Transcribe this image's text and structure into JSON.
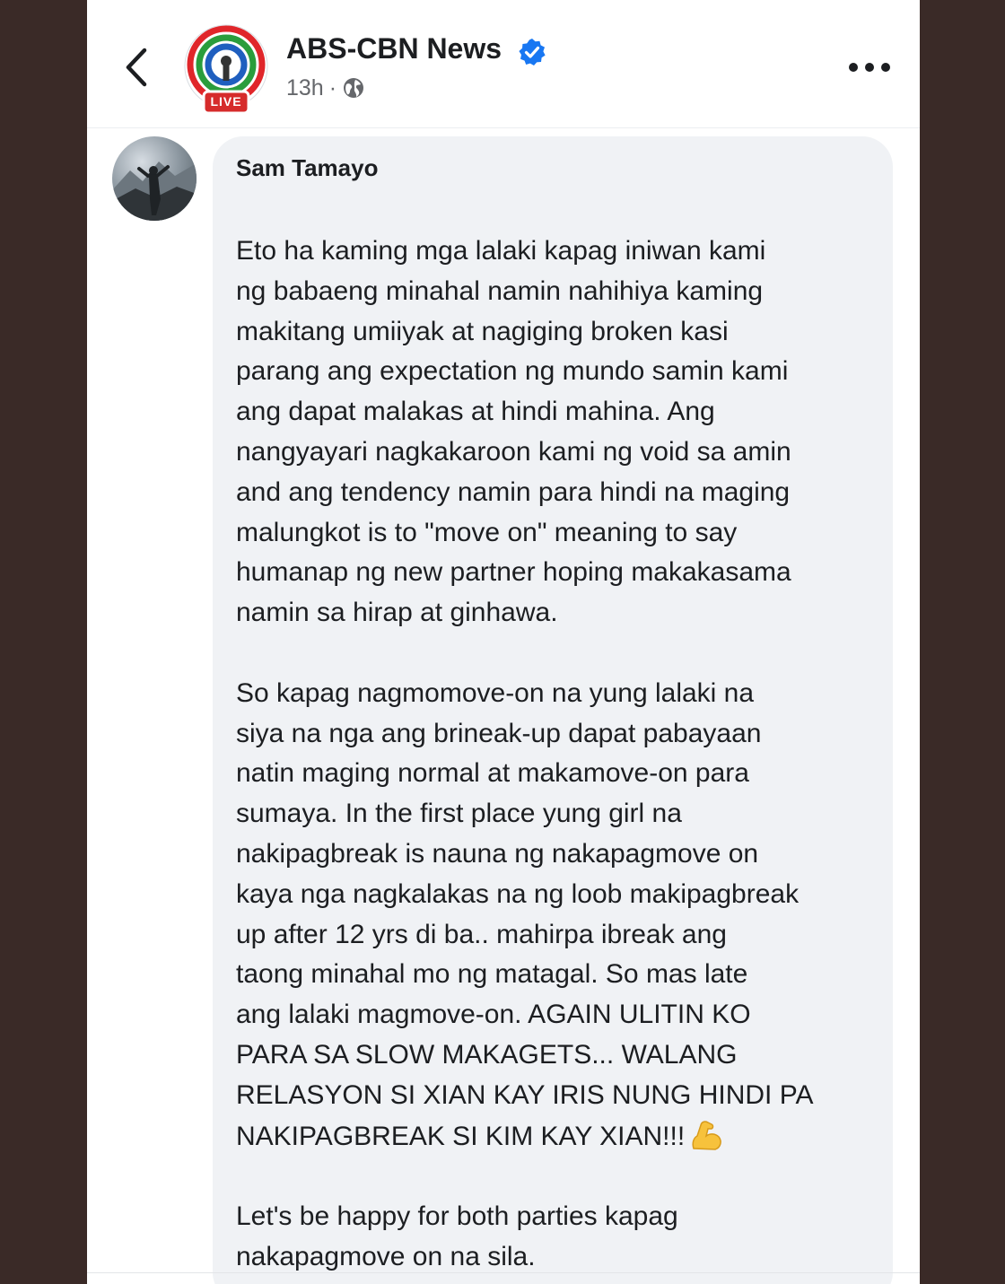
{
  "colors": {
    "frame": "#3a2a27",
    "surface": "#ffffff",
    "bubble": "#f0f2f5",
    "text_primary": "#1c1e21",
    "text_secondary": "#65676b",
    "verified": "#1877f2",
    "live_red": "#d62b2b"
  },
  "header": {
    "back_icon": "chevron-left-icon",
    "page_name": "ABS-CBN News",
    "verified_icon": "verified-badge-icon",
    "live_badge": "LIVE",
    "timestamp": "13h",
    "separator": "·",
    "audience_icon": "globe-icon",
    "more_icon": "more-horizontal-icon"
  },
  "comment": {
    "author": "Sam Tamayo",
    "paragraphs": [
      "Eto ha kaming mga lalaki kapag iniwan kami\nng babaeng minahal namin nahihiya kaming\nmakitang umiiyak at nagiging broken kasi\nparang ang expectation ng mundo samin kami\nang dapat malakas at hindi mahina. Ang\nnangyayari nagkakaroon kami ng void sa amin\nand ang tendency namin para hindi na maging\nmalungkot is to \"move on\" meaning to say\nhumanap ng new partner hoping makakasama\nnamin sa hirap at ginhawa.",
      "So kapag nagmomove-on na yung lalaki na\nsiya na nga ang brineak-up dapat pabayaan\nnatin maging normal at makamove-on para\nsumaya. In the first place yung girl na\nnakipagbreak is nauna ng nakapagmove on\nkaya nga nagkalakas na ng loob makipagbreak\nup after 12 yrs di ba.. mahirpa ibreak ang\ntaong minahal mo ng matagal. So mas late\nang lalaki magmove-on. AGAIN ULITIN KO\nPARA SA SLOW MAKAGETS... WALANG\nRELASYON SI XIAN KAY IRIS NUNG HINDI PA\nNAKIPAGBREAK SI KIM KAY XIAN!!!",
      "Let's be happy for both parties kapag\nnakapagmove on na sila."
    ],
    "emoji_icon": "flexed-biceps-icon"
  }
}
